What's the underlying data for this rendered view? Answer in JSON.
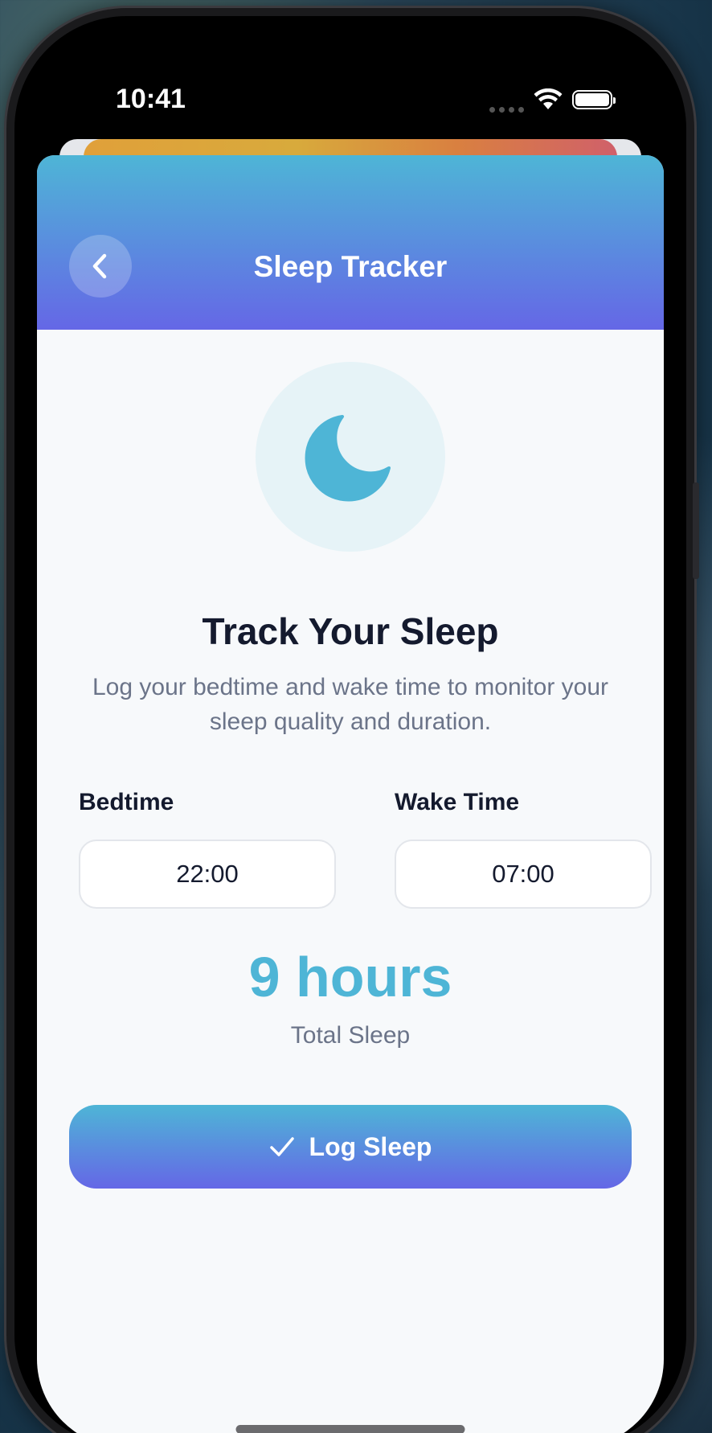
{
  "status_bar": {
    "time": "10:41",
    "icons": [
      "cellular-dots-icon",
      "wifi-icon",
      "battery-icon"
    ]
  },
  "header": {
    "back_icon": "chevron-left-icon",
    "title": "Sleep Tracker"
  },
  "hero": {
    "icon": "moon-icon",
    "title": "Track Your Sleep",
    "description": "Log your bedtime and wake time to monitor your sleep quality and duration."
  },
  "form": {
    "bedtime": {
      "label": "Bedtime",
      "value": "22:00"
    },
    "wake_time": {
      "label": "Wake Time",
      "value": "07:00"
    }
  },
  "summary": {
    "duration": "9 hours",
    "label": "Total Sleep"
  },
  "log_button": {
    "icon": "checkmark-icon",
    "label": "Log Sleep"
  },
  "colors": {
    "accent": "#4eb5d6",
    "gradient_start": "#4eb5d6",
    "gradient_end": "#6567e6",
    "title_text": "#141a2e",
    "muted_text": "#6b7489",
    "sheet_background": "#f7f9fb"
  }
}
